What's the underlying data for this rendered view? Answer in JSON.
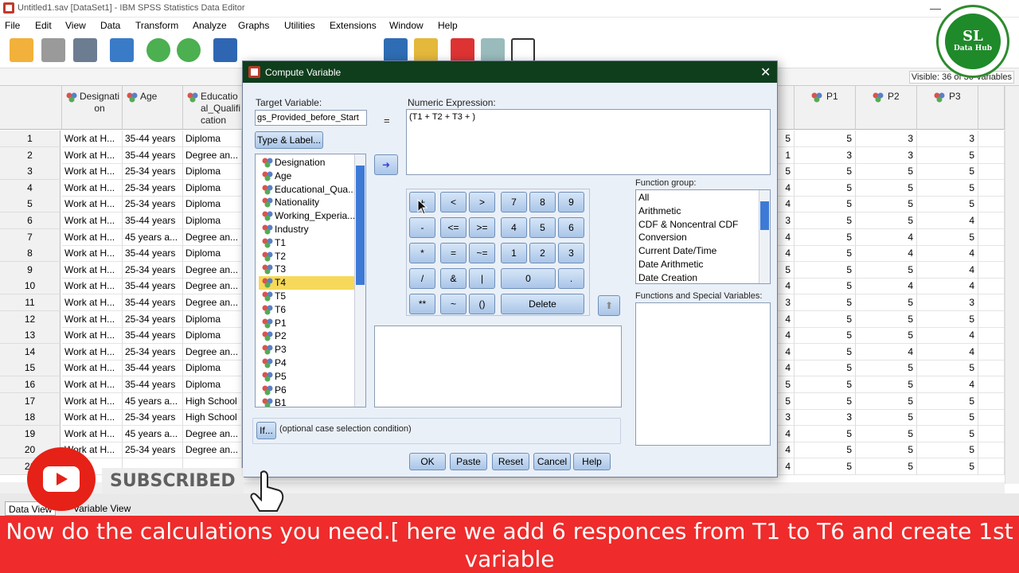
{
  "window": {
    "title": "Untitled1.sav [DataSet1] - IBM SPSS Statistics Data Editor"
  },
  "menu": [
    "File",
    "Edit",
    "View",
    "Data",
    "Transform",
    "Analyze",
    "Graphs",
    "Utilities",
    "Extensions",
    "Window",
    "Help"
  ],
  "visible_label": "Visible: 36 of 36 Variables",
  "grid": {
    "left_headers": [
      [
        "Designati",
        "on"
      ],
      [
        "Age",
        ""
      ],
      [
        "Educatio",
        "al_Qualifi",
        "cation"
      ]
    ],
    "right_headers": [
      "P1",
      "P2",
      "P3"
    ],
    "rows": [
      {
        "n": "1",
        "d": "Work at H...",
        "a": "35-44 years",
        "e": "Diploma",
        "v": [
          "5",
          "5",
          "3",
          "3"
        ]
      },
      {
        "n": "2",
        "d": "Work at H...",
        "a": "35-44 years",
        "e": "Degree an...",
        "v": [
          "1",
          "3",
          "3",
          "5"
        ]
      },
      {
        "n": "3",
        "d": "Work at H...",
        "a": "25-34 years",
        "e": "Diploma",
        "v": [
          "5",
          "5",
          "5",
          "5"
        ]
      },
      {
        "n": "4",
        "d": "Work at H...",
        "a": "25-34 years",
        "e": "Diploma",
        "v": [
          "4",
          "5",
          "5",
          "5"
        ]
      },
      {
        "n": "5",
        "d": "Work at H...",
        "a": "25-34 years",
        "e": "Diploma",
        "v": [
          "4",
          "5",
          "5",
          "5"
        ]
      },
      {
        "n": "6",
        "d": "Work at H...",
        "a": "35-44 years",
        "e": "Diploma",
        "v": [
          "3",
          "5",
          "5",
          "4"
        ]
      },
      {
        "n": "7",
        "d": "Work at H...",
        "a": "45 years a...",
        "e": "Degree an...",
        "v": [
          "4",
          "5",
          "4",
          "5"
        ]
      },
      {
        "n": "8",
        "d": "Work at H...",
        "a": "35-44 years",
        "e": "Diploma",
        "v": [
          "4",
          "5",
          "4",
          "4"
        ]
      },
      {
        "n": "9",
        "d": "Work at H...",
        "a": "25-34 years",
        "e": "Degree an...",
        "v": [
          "5",
          "5",
          "5",
          "4"
        ]
      },
      {
        "n": "10",
        "d": "Work at H...",
        "a": "35-44 years",
        "e": "Degree an...",
        "v": [
          "4",
          "5",
          "4",
          "4"
        ]
      },
      {
        "n": "11",
        "d": "Work at H...",
        "a": "35-44 years",
        "e": "Degree an...",
        "v": [
          "3",
          "5",
          "5",
          "3"
        ]
      },
      {
        "n": "12",
        "d": "Work at H...",
        "a": "25-34 years",
        "e": "Diploma",
        "v": [
          "4",
          "5",
          "5",
          "5"
        ]
      },
      {
        "n": "13",
        "d": "Work at H...",
        "a": "35-44 years",
        "e": "Diploma",
        "v": [
          "4",
          "5",
          "5",
          "4"
        ]
      },
      {
        "n": "14",
        "d": "Work at H...",
        "a": "25-34 years",
        "e": "Degree an...",
        "v": [
          "4",
          "5",
          "4",
          "4"
        ]
      },
      {
        "n": "15",
        "d": "Work at H...",
        "a": "35-44 years",
        "e": "Diploma",
        "v": [
          "4",
          "5",
          "5",
          "5"
        ]
      },
      {
        "n": "16",
        "d": "Work at H...",
        "a": "35-44 years",
        "e": "Diploma",
        "v": [
          "5",
          "5",
          "5",
          "4"
        ]
      },
      {
        "n": "17",
        "d": "Work at H...",
        "a": "45 years a...",
        "e": "High School",
        "v": [
          "5",
          "5",
          "5",
          "5"
        ]
      },
      {
        "n": "18",
        "d": "Work at H...",
        "a": "25-34 years",
        "e": "High School",
        "v": [
          "3",
          "3",
          "5",
          "5"
        ]
      },
      {
        "n": "19",
        "d": "Work at H...",
        "a": "45 years a...",
        "e": "Degree an...",
        "v": [
          "4",
          "5",
          "5",
          "5"
        ]
      },
      {
        "n": "20",
        "d": "Work at H...",
        "a": "25-34 years",
        "e": "Degree an...",
        "v": [
          "4",
          "5",
          "5",
          "5"
        ]
      },
      {
        "n": "21",
        "d": "",
        "a": "",
        "e": "",
        "v": [
          "4",
          "5",
          "5",
          "5"
        ]
      }
    ]
  },
  "bottom_tabs": [
    "Data View",
    "Variable View"
  ],
  "dialog": {
    "title": "Compute Variable",
    "target_label": "Target Variable:",
    "target_value": "gs_Provided_before_Start",
    "equals": "=",
    "expr_label": "Numeric Expression:",
    "expr_value": "(T1 + T2 + T3 + )",
    "type_label_btn": "Type & Label...",
    "variables": [
      "Designation",
      "Age",
      "Educational_Qua...",
      "Nationality",
      "Working_Experia...",
      "Industry",
      "T1",
      "T2",
      "T3",
      "T4",
      "T5",
      "T6",
      "P1",
      "P2",
      "P3",
      "P4",
      "P5",
      "P6",
      "B1"
    ],
    "selected_variable": "T4",
    "keypad": [
      [
        "+",
        "<",
        ">",
        "7",
        "8",
        "9"
      ],
      [
        "-",
        "<=",
        ">=",
        "4",
        "5",
        "6"
      ],
      [
        "*",
        "=",
        "~=",
        "1",
        "2",
        "3"
      ],
      [
        "/",
        "&",
        "|",
        "0",
        "."
      ],
      [
        "**",
        "~",
        "()",
        "Delete"
      ]
    ],
    "function_group_label": "Function group:",
    "function_groups": [
      "All",
      "Arithmetic",
      "CDF & Noncentral CDF",
      "Conversion",
      "Current Date/Time",
      "Date Arithmetic",
      "Date Creation"
    ],
    "functions_label": "Functions and Special Variables:",
    "if_btn": "If...",
    "if_text": "(optional case selection condition)",
    "buttons": [
      "OK",
      "Paste",
      "Reset",
      "Cancel",
      "Help"
    ]
  },
  "overlay": {
    "subscribed": "SUBSCRIBED",
    "logo_top": "SL",
    "logo_bottom": "Data Hub"
  },
  "banner": "Now do the calculations you need.[ here we add 6 responces from T1 to T6 and create 1st variable"
}
